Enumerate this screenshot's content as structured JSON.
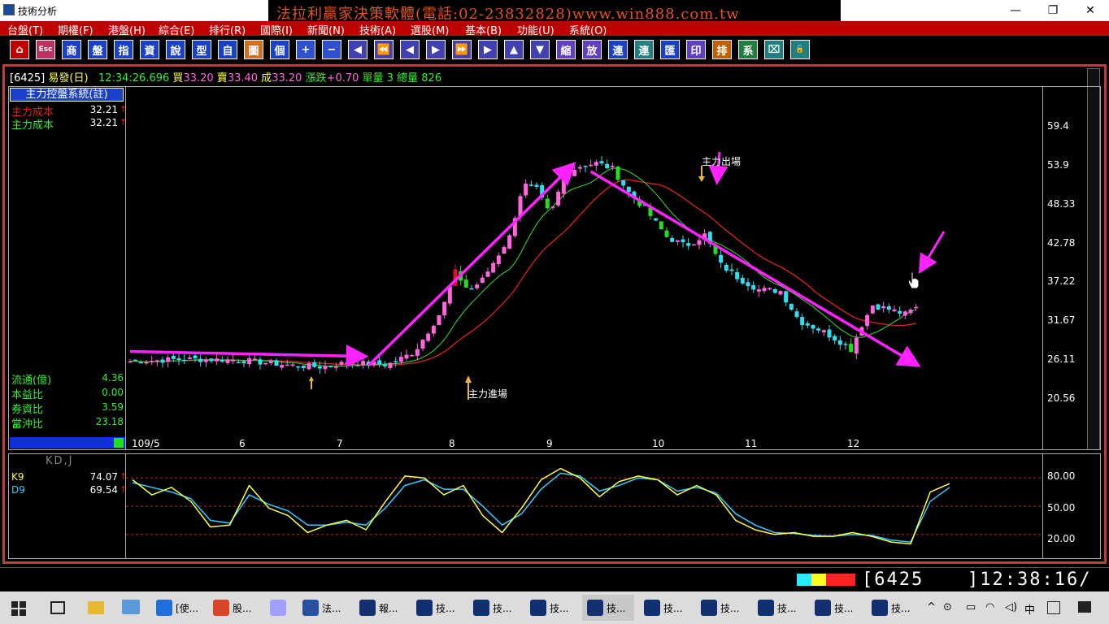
{
  "window": {
    "title": "技術分析",
    "ad_banner": "法拉利贏家決策軟體(電話:02-23832828)www.win888.com.tw",
    "minimize": "—",
    "restore": "❐",
    "close": "✕"
  },
  "menu": [
    {
      "label": "台盤(T)"
    },
    {
      "label": "期權(F)"
    },
    {
      "label": "港盤(H)"
    },
    {
      "label": "綜合(E)"
    },
    {
      "label": "排行(R)"
    },
    {
      "label": "國際(I)"
    },
    {
      "label": "新聞(N)"
    },
    {
      "label": "技術(A)"
    },
    {
      "label": "選股(M)"
    },
    {
      "label": "基本(B)"
    },
    {
      "label": "功能(U)"
    },
    {
      "label": "系統(O)"
    }
  ],
  "toolbar": [
    {
      "glyph": "⌂",
      "icon": "home-icon",
      "bg": "#c00000"
    },
    {
      "glyph": "Esc",
      "icon": "esc-icon",
      "bg": "#c03060"
    },
    {
      "glyph": "商",
      "icon": "shang-icon",
      "bg": "#1a40c8"
    },
    {
      "glyph": "盤",
      "icon": "pan-icon",
      "bg": "#1a40c8"
    },
    {
      "glyph": "指",
      "icon": "index-icon",
      "bg": "#1a40c8"
    },
    {
      "glyph": "資",
      "icon": "zi-icon",
      "bg": "#1a40c8"
    },
    {
      "glyph": "說",
      "icon": "shuo-icon",
      "bg": "#1a40c8"
    },
    {
      "glyph": "型",
      "icon": "xing-icon",
      "bg": "#1a40c8"
    },
    {
      "glyph": "自",
      "icon": "zi2-icon",
      "bg": "#1a40c8"
    },
    {
      "glyph": "圖",
      "icon": "chart-icon",
      "bg": "#d07020"
    },
    {
      "glyph": "個",
      "icon": "ge-icon",
      "bg": "#1a40c8"
    },
    {
      "glyph": "+",
      "icon": "plus-icon",
      "bg": "#3050d0"
    },
    {
      "glyph": "−",
      "icon": "minus-icon",
      "bg": "#3050d0"
    },
    {
      "glyph": "◀",
      "icon": "arrow-left-icon",
      "bg": "#4040b0"
    },
    {
      "glyph": "⏪",
      "icon": "rewind-icon",
      "bg": "#4040b0"
    },
    {
      "glyph": "◀",
      "icon": "prev-icon",
      "bg": "#4040b0"
    },
    {
      "glyph": "▶",
      "icon": "next-icon",
      "bg": "#4040b0"
    },
    {
      "glyph": "⏩",
      "icon": "forward-icon",
      "bg": "#4040b0"
    },
    {
      "glyph": "▶",
      "icon": "arrow-right-icon",
      "bg": "#4040b0"
    },
    {
      "glyph": "▲",
      "icon": "up-icon",
      "bg": "#4040b0"
    },
    {
      "glyph": "▼",
      "icon": "down-icon",
      "bg": "#4040b0"
    },
    {
      "glyph": "縮",
      "icon": "shrink-icon",
      "bg": "#6040c0"
    },
    {
      "glyph": "放",
      "icon": "zoom-icon",
      "bg": "#6040c0"
    },
    {
      "glyph": "連",
      "icon": "lian-icon",
      "bg": "#1a40c8"
    },
    {
      "glyph": "連",
      "icon": "lian2-icon",
      "bg": "#208080"
    },
    {
      "glyph": "匯",
      "icon": "hui-icon",
      "bg": "#1a40c8"
    },
    {
      "glyph": "印",
      "icon": "print-icon",
      "bg": "#6040c0"
    },
    {
      "glyph": "排",
      "icon": "pai-icon",
      "bg": "#c06000"
    },
    {
      "glyph": "系",
      "icon": "xi-icon",
      "bg": "#208040"
    },
    {
      "glyph": "⌧",
      "icon": "window-icon",
      "bg": "#208080"
    },
    {
      "glyph": "🔓",
      "icon": "lock-icon",
      "bg": "#208080"
    }
  ],
  "quote": {
    "code": "[6425]",
    "name": "易發(日)",
    "time": "12:34:26.696",
    "buy_label": "買",
    "buy": "33.20",
    "sell_label": "賣",
    "sell": "33.40",
    "deal_label": "成",
    "deal": "33.20",
    "change_label": "漲跌",
    "change": "+0.70",
    "vol_label": "單量",
    "vol": "3",
    "total_label": "總量",
    "total": "826"
  },
  "side": {
    "system_title": "主力控盤系統(註)",
    "cost1_label": "主力成本",
    "cost1": "32.21",
    "cost2_label": "主力成本",
    "cost2": "32.21",
    "stats": [
      {
        "label": "流通(億)",
        "value": "4.36"
      },
      {
        "label": "本益比",
        "value": "0.00"
      },
      {
        "label": "券資比",
        "value": "3.59"
      },
      {
        "label": "當沖比",
        "value": "23.18"
      }
    ]
  },
  "annotations": {
    "enter": "主力進場",
    "exit": "主力出場"
  },
  "colors": {
    "up": "#ff66dd",
    "up_strong": "#e01020",
    "down": "#33ddee",
    "down_strong": "#22dd22",
    "ma_short": "#33cc33",
    "ma_long": "#dd2222",
    "trend": "#ff22ff",
    "k": "#ffff44",
    "d": "#33ccff"
  },
  "kd": {
    "title": "KD,J",
    "k_label": "K9",
    "k_value": "74.07",
    "d_label": "D9",
    "d_value": "69.54"
  },
  "chart_data": [
    {
      "type": "candlestick",
      "title": "",
      "x_ticks": [
        "109/5",
        "6",
        "7",
        "8",
        "9",
        "10",
        "11",
        "12"
      ],
      "y_ticks": [
        "59.4",
        "53.9",
        "48.33",
        "42.78",
        "37.22",
        "31.67",
        "26.11",
        "20.56"
      ],
      "ylim": [
        20.56,
        59.4
      ],
      "close_path": [
        {
          "t": 0,
          "v": 25.8
        },
        {
          "t": 20,
          "v": 26.1
        },
        {
          "t": 40,
          "v": 26.0
        },
        {
          "t": 60,
          "v": 25.2
        },
        {
          "t": 70,
          "v": 25.0
        },
        {
          "t": 80,
          "v": 25.6
        },
        {
          "t": 95,
          "v": 25.3
        },
        {
          "t": 100,
          "v": 26.2
        },
        {
          "t": 105,
          "v": 27.2
        },
        {
          "t": 115,
          "v": 33.0
        },
        {
          "t": 120,
          "v": 38.5
        },
        {
          "t": 125,
          "v": 35.8
        },
        {
          "t": 130,
          "v": 37.4
        },
        {
          "t": 140,
          "v": 43.5
        },
        {
          "t": 145,
          "v": 51.0
        },
        {
          "t": 150,
          "v": 50.2
        },
        {
          "t": 155,
          "v": 46.5
        },
        {
          "t": 160,
          "v": 52.0
        },
        {
          "t": 165,
          "v": 53.5
        },
        {
          "t": 172,
          "v": 54.0
        },
        {
          "t": 178,
          "v": 53.2
        },
        {
          "t": 184,
          "v": 49.8
        },
        {
          "t": 190,
          "v": 47.5
        },
        {
          "t": 198,
          "v": 43.5
        },
        {
          "t": 205,
          "v": 42.2
        },
        {
          "t": 212,
          "v": 43.8
        },
        {
          "t": 218,
          "v": 39.5
        },
        {
          "t": 225,
          "v": 37.5
        },
        {
          "t": 232,
          "v": 36.0
        },
        {
          "t": 240,
          "v": 35.8
        },
        {
          "t": 247,
          "v": 31.5
        },
        {
          "t": 255,
          "v": 30.2
        },
        {
          "t": 262,
          "v": 28.6
        },
        {
          "t": 266,
          "v": 27.5
        },
        {
          "t": 270,
          "v": 31.0
        },
        {
          "t": 274,
          "v": 33.8
        },
        {
          "t": 280,
          "v": 33.2
        },
        {
          "t": 286,
          "v": 32.5
        },
        {
          "t": 290,
          "v": 33.4
        }
      ],
      "trend_lines": [
        {
          "from": [
            0,
            27.2
          ],
          "to": [
            86,
            26.5
          ]
        },
        {
          "from": [
            88,
            25.2
          ],
          "to": [
            163,
            53.6
          ]
        },
        {
          "from": [
            170,
            52.8
          ],
          "to": [
            290,
            25.4
          ]
        }
      ]
    },
    {
      "type": "line",
      "title": "KD,J",
      "y_ticks": [
        "80.00",
        "50.00",
        "20.00"
      ],
      "ylim": [
        0,
        100
      ],
      "series": [
        {
          "name": "K9",
          "values": [
            78,
            62,
            70,
            55,
            28,
            30,
            72,
            48,
            40,
            22,
            30,
            35,
            25,
            55,
            82,
            80,
            62,
            72,
            40,
            22,
            48,
            78,
            90,
            80,
            60,
            76,
            82,
            78,
            62,
            72,
            62,
            35,
            25,
            20,
            22,
            18,
            18,
            22,
            18,
            12,
            10,
            65,
            74
          ]
        },
        {
          "name": "D9",
          "values": [
            75,
            70,
            65,
            58,
            35,
            32,
            62,
            52,
            45,
            30,
            30,
            33,
            30,
            48,
            72,
            78,
            68,
            68,
            50,
            30,
            42,
            68,
            85,
            82,
            66,
            72,
            80,
            78,
            66,
            70,
            64,
            42,
            30,
            22,
            21,
            19,
            18,
            20,
            19,
            14,
            12,
            55,
            70
          ]
        }
      ]
    }
  ],
  "status": {
    "code": "[6425",
    "time": "]12:38:16/"
  },
  "taskbar": {
    "tasks": [
      {
        "label": "[使...",
        "icon": "ie-icon",
        "color": "#1e6fd9"
      },
      {
        "label": "股...",
        "icon": "chrome-icon",
        "color": "#d9452b"
      },
      {
        "label": "",
        "icon": "paint-icon",
        "color": "#a0a0ff"
      },
      {
        "label": "法...",
        "icon": "app-icon",
        "color": "#2850a0"
      },
      {
        "label": "報...",
        "icon": "chart-app-icon",
        "color": "#103070"
      },
      {
        "label": "技...",
        "icon": "chart-app-icon",
        "color": "#103070"
      },
      {
        "label": "技...",
        "icon": "chart-app-icon",
        "color": "#103070"
      },
      {
        "label": "技...",
        "icon": "chart-app-icon",
        "color": "#103070"
      },
      {
        "label": "技...",
        "icon": "chart-app-icon",
        "color": "#103070"
      },
      {
        "label": "技...",
        "icon": "chart-app-icon",
        "color": "#103070"
      },
      {
        "label": "技...",
        "icon": "chart-app-icon",
        "color": "#103070"
      },
      {
        "label": "技...",
        "icon": "chart-app-icon",
        "color": "#103070"
      },
      {
        "label": "技...",
        "icon": "chart-app-icon",
        "color": "#103070"
      },
      {
        "label": "技...",
        "icon": "chart-app-icon",
        "color": "#103070"
      }
    ],
    "ime": "中",
    "tray_chevron": "^"
  }
}
